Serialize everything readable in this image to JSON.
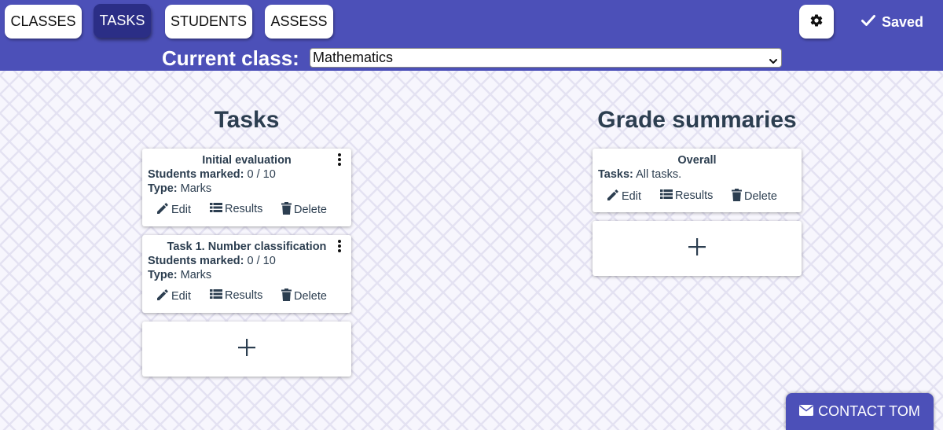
{
  "nav": {
    "classes_label": "CLASSES",
    "tasks_label": "TASKS",
    "students_label": "STUDENTS",
    "assess_label": "ASSESS",
    "active_tab": "TASKS"
  },
  "header": {
    "saved_label": "Saved",
    "current_class_label": "Current class:",
    "current_class_value": "Mathematics"
  },
  "tasks": {
    "title": "Tasks",
    "items": [
      {
        "name": "Initial evaluation",
        "students_marked_label": "Students marked:",
        "students_marked_value": "0 / 10",
        "type_label": "Type:",
        "type_value": "Marks",
        "edit_label": "Edit",
        "results_label": "Results",
        "delete_label": "Delete"
      },
      {
        "name": "Task 1. Number classification",
        "students_marked_label": "Students marked:",
        "students_marked_value": "0 / 10",
        "type_label": "Type:",
        "type_value": "Marks",
        "edit_label": "Edit",
        "results_label": "Results",
        "delete_label": "Delete"
      }
    ]
  },
  "grade_summaries": {
    "title": "Grade summaries",
    "items": [
      {
        "name": "Overall",
        "tasks_label": "Tasks:",
        "tasks_value": "All tasks.",
        "edit_label": "Edit",
        "results_label": "Results",
        "delete_label": "Delete"
      }
    ]
  },
  "contact": {
    "label": "CONTACT TOM"
  },
  "colors": {
    "header_bg": "#4c50b8",
    "active_tab_bg": "#2b2e86",
    "text": "#2c3e50",
    "page_bg": "#f7f6fd"
  },
  "icons": {
    "settings": "gear-icon",
    "saved": "check-icon",
    "edit": "pencil-icon",
    "results": "list-icon",
    "delete": "trash-icon",
    "menu": "kebab-icon",
    "add": "plus-icon",
    "contact": "envelope-icon"
  }
}
